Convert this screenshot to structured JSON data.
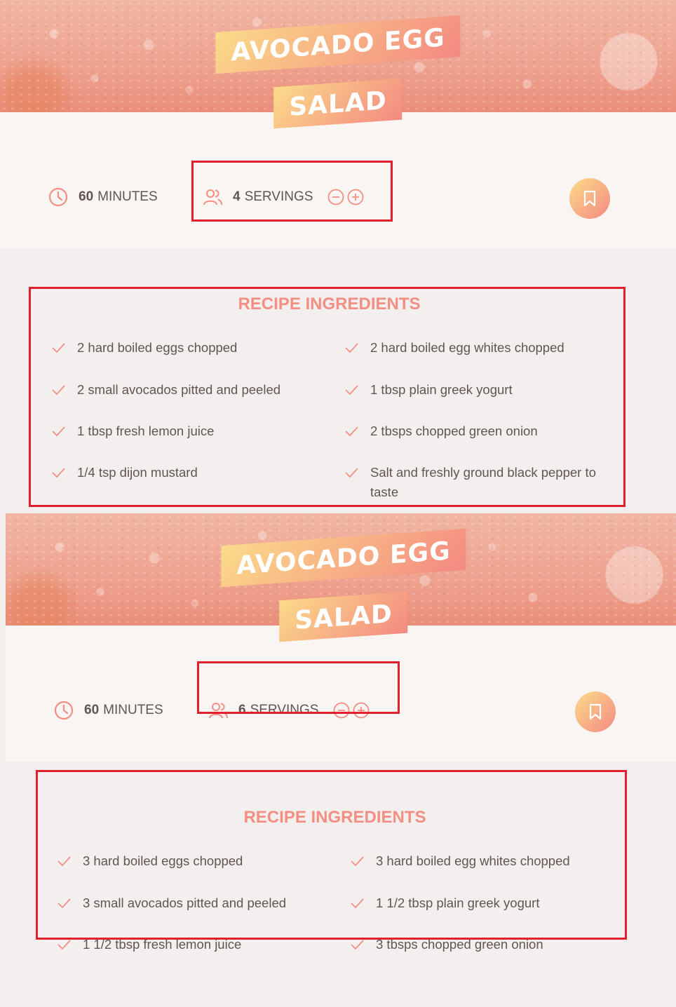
{
  "recipe_views": [
    {
      "title_line1": "Avocado Egg",
      "title_line2": "Salad",
      "time_value": "60",
      "time_unit": "Minutes",
      "servings_value": "4",
      "servings_unit": "Servings",
      "ingredients_heading": "Recipe Ingredients",
      "ingredients": [
        "2 hard boiled eggs chopped",
        "2 hard boiled egg whites chopped",
        "2 small avocados pitted and peeled",
        "1 tbsp plain greek yogurt",
        "1 tbsp fresh lemon juice",
        "2 tbsps chopped green onion",
        "1/4 tsp dijon mustard",
        "Salt and freshly ground black pepper to taste"
      ]
    },
    {
      "title_line1": "Avocado Egg",
      "title_line2": "Salad",
      "time_value": "60",
      "time_unit": "Minutes",
      "servings_value": "6",
      "servings_unit": "Servings",
      "ingredients_heading": "Recipe Ingredients",
      "ingredients": [
        "3 hard boiled eggs chopped",
        "3 hard boiled egg whites chopped",
        "3 small avocados pitted and peeled",
        "1 1/2 tbsp plain greek yogurt",
        "1 1/2 tbsp fresh lemon juice",
        "3 tbsps chopped green onion"
      ]
    }
  ],
  "colors": {
    "accent": "#f38e82",
    "gradient_start": "#fbdb89",
    "gradient_end": "#f48982",
    "highlight_box": "#e0202c",
    "text": "#615551"
  },
  "icons": {
    "time": "clock-icon",
    "servings": "users-icon",
    "decrease": "minus-circle-icon",
    "increase": "plus-circle-icon",
    "bookmark": "bookmark-icon",
    "ingredient": "check-icon"
  }
}
